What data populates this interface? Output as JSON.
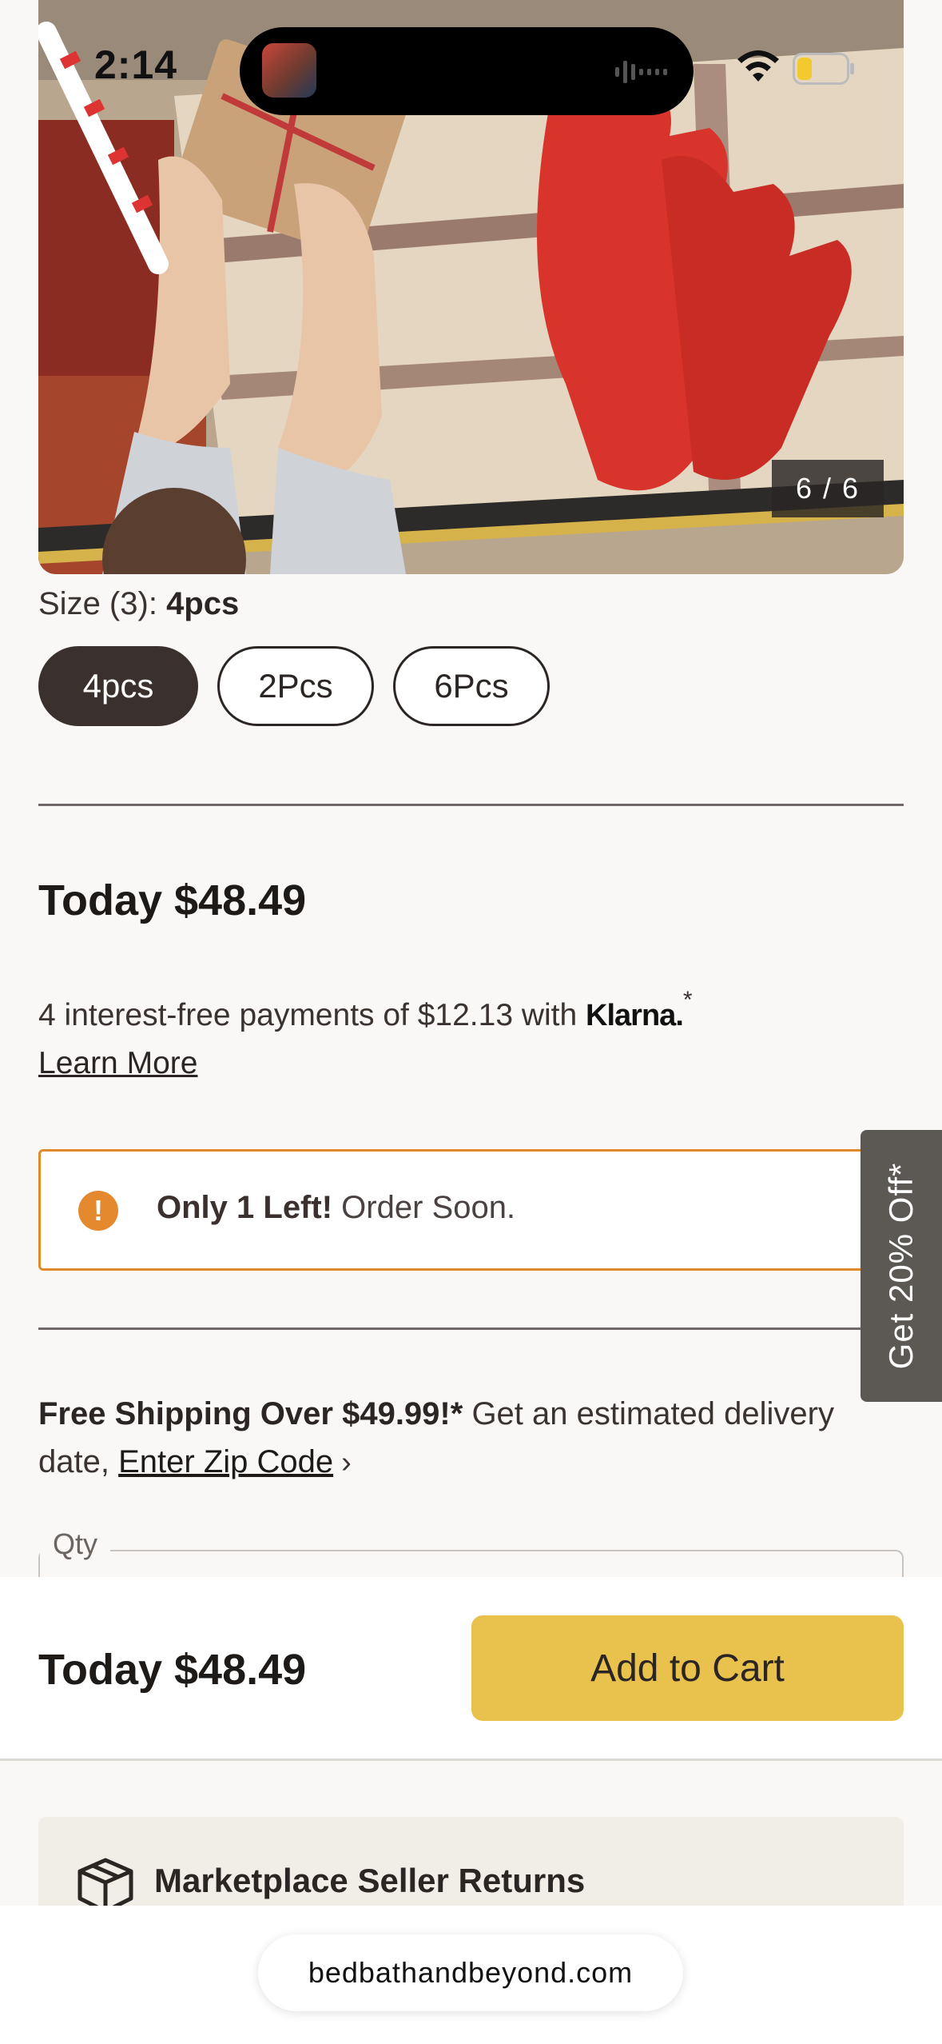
{
  "status_bar": {
    "time": "2:14"
  },
  "gallery": {
    "counter": "6 / 6"
  },
  "size": {
    "label_prefix": "Size (3):",
    "selected": "4pcs",
    "options": [
      "4pcs",
      "2Pcs",
      "6Pcs"
    ]
  },
  "pricing": {
    "today_price": "Today $48.49",
    "klarna_text": "4 interest-free payments of $12.13 with",
    "klarna_brand": "Klarna.",
    "klarna_asterisk": "*",
    "learn_more": "Learn More"
  },
  "stock": {
    "bold": "Only 1 Left!",
    "rest": "Order Soon."
  },
  "promo_tab": "Get 20% Off*",
  "shipping": {
    "bold": "Free Shipping Over $49.99!*",
    "text": "Get an estimated delivery date,",
    "zip_link": "Enter Zip Code"
  },
  "qty": {
    "label": "Qty"
  },
  "sticky_bar": {
    "price": "Today $48.49",
    "add_to_cart": "Add to Cart"
  },
  "returns": {
    "title": "Marketplace Seller Returns"
  },
  "browser": {
    "url": "bedbathandbeyond.com"
  },
  "colors": {
    "accent": "#e8c24c",
    "alert": "#e4892e",
    "selected_chip": "#3a302d"
  }
}
